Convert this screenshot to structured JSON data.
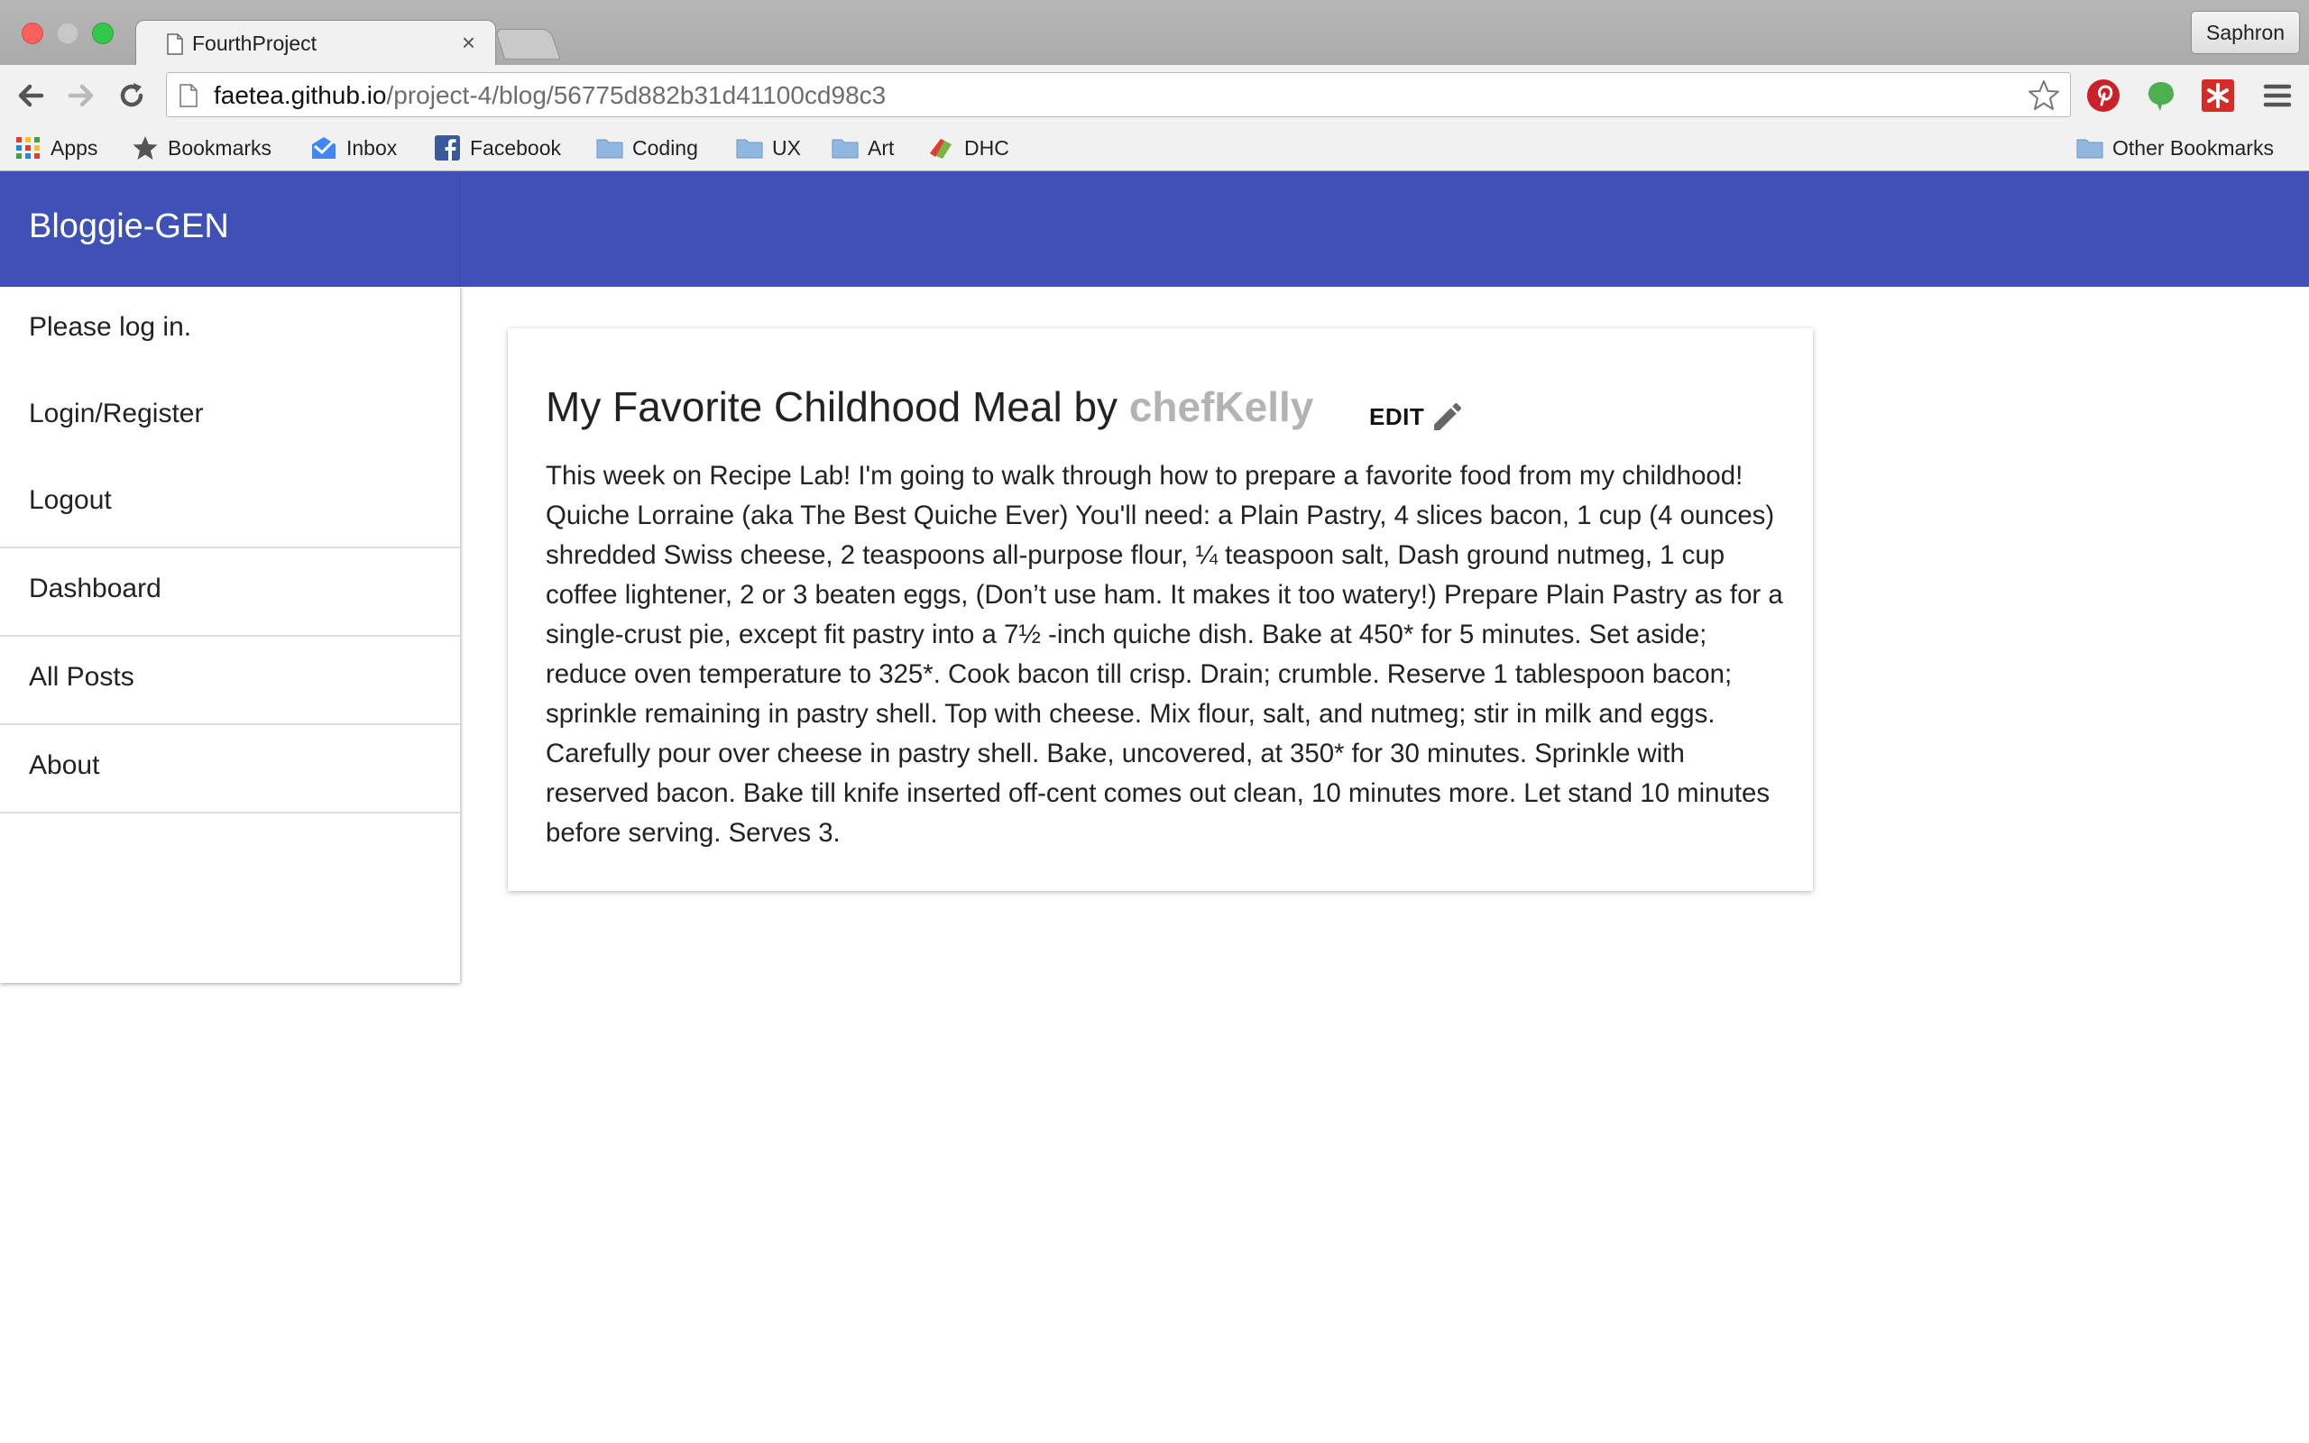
{
  "browser": {
    "tab_title": "FourthProject",
    "tab_close": "×",
    "profile_name": "Saphron",
    "url_host": "faetea.github.io",
    "url_path": "/project-4/blog/56775d882b31d41100cd98c3",
    "bookmarks": [
      "Apps",
      "Bookmarks",
      "Inbox",
      "Facebook",
      "Coding",
      "UX",
      "Art",
      "DHC"
    ],
    "other_bookmarks": "Other Bookmarks"
  },
  "app": {
    "brand": "Bloggie-GEN",
    "accent_color": "#3f51b5"
  },
  "nav": {
    "items": [
      "Please log in.",
      "Login/Register",
      "Logout",
      "Dashboard",
      "All Posts",
      "About"
    ]
  },
  "post": {
    "title": "My Favorite Childhood Meal by ",
    "author": "chefKelly",
    "edit_label": "EDIT",
    "body": "This week on Recipe Lab! I'm going to walk through how to prepare a favorite food from my childhood! Quiche Lorraine (aka The Best Quiche Ever) You'll need: a Plain Pastry, 4 slices bacon, 1 cup (4 ounces) shredded Swiss cheese, 2 teaspoons all-purpose flour, ¼ teaspoon salt, Dash ground nutmeg, 1 cup coffee lightener, 2 or 3 beaten eggs, (Don’t use ham. It makes it too watery!) Prepare Plain Pastry as for a single-crust pie, except fit pastry into a 7½ -inch quiche dish. Bake at 450* for 5 minutes. Set aside; reduce oven temperature to 325*. Cook bacon till crisp. Drain; crumble. Reserve 1 tablespoon bacon; sprinkle remaining in pastry shell. Top with cheese. Mix flour, salt, and nutmeg; stir in milk and eggs. Carefully pour over cheese in pastry shell. Bake, uncovered, at 350* for 30 minutes. Sprinkle with reserved bacon. Bake till knife inserted off-cent comes out clean, 10 minutes more. Let stand 10 minutes before serving. Serves 3."
  }
}
